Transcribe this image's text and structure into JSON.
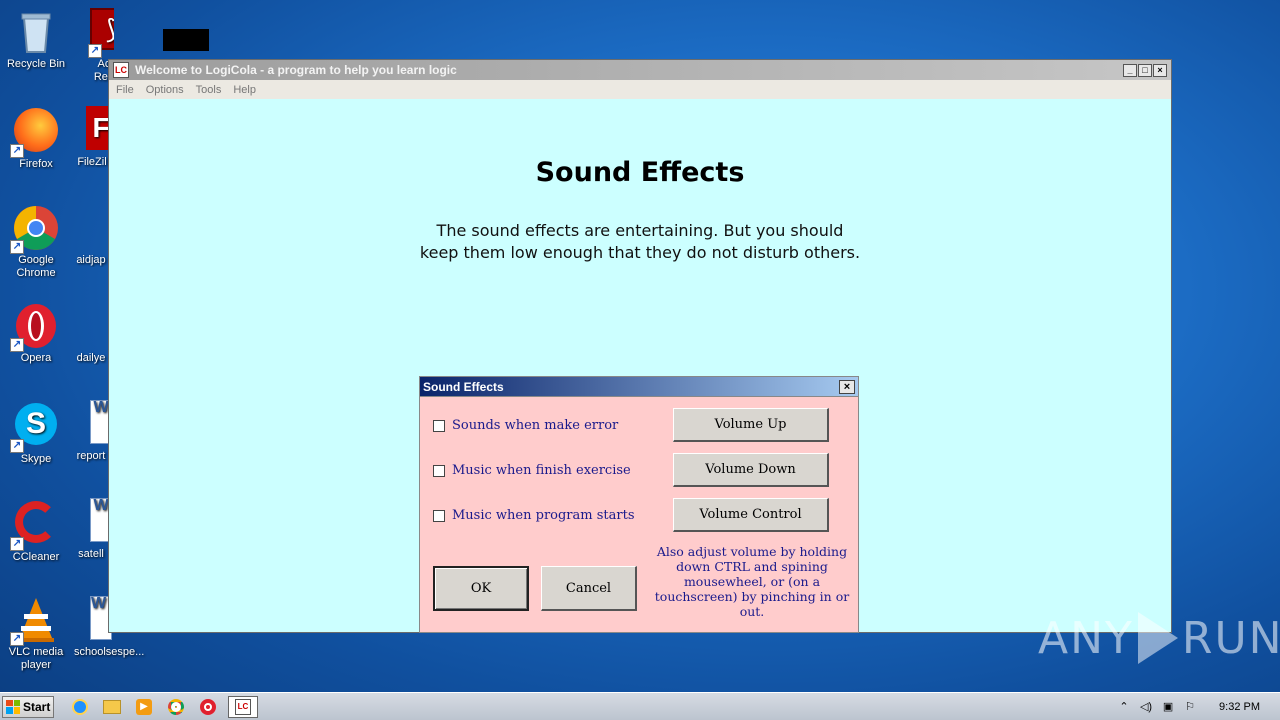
{
  "desktop": {
    "icons": [
      {
        "label": "Recycle Bin",
        "icon": "recycle-bin-icon"
      },
      {
        "label": "Acr Rea",
        "icon": "acrobat-reader-icon"
      },
      {
        "label": "Firefox",
        "icon": "firefox-icon"
      },
      {
        "label": "FileZil",
        "icon": "filezilla-icon"
      },
      {
        "label": "Google Chrome",
        "icon": "chrome-icon"
      },
      {
        "label": "aidjap",
        "icon": "file-icon"
      },
      {
        "label": "Opera",
        "icon": "opera-icon"
      },
      {
        "label": "dailye",
        "icon": "file-icon"
      },
      {
        "label": "Skype",
        "icon": "skype-icon"
      },
      {
        "label": "report",
        "icon": "word-doc-icon"
      },
      {
        "label": "CCleaner",
        "icon": "ccleaner-icon"
      },
      {
        "label": "satell",
        "icon": "word-doc-icon"
      },
      {
        "label": "VLC media player",
        "icon": "vlc-icon"
      },
      {
        "label": "schoolsespe...",
        "icon": "word-doc-icon"
      }
    ]
  },
  "window": {
    "title": "Welcome to LogiCola - a program to help you learn logic",
    "controls": {
      "minimize": "_",
      "maximize": "□",
      "close": "×"
    },
    "menu": [
      "File",
      "Options",
      "Tools",
      "Help"
    ],
    "content_bg": "#ccffff",
    "heading": "Sound Effects",
    "text_line1": "The sound effects are entertaining. But you should",
    "text_line2": "keep them low enough that they do not disturb others."
  },
  "dialog": {
    "title": "Sound Effects",
    "close": "×",
    "bg": "#ffcccc",
    "checkboxes": [
      {
        "label": "Sounds when make error",
        "checked": false
      },
      {
        "label": "Music when finish exercise",
        "checked": false
      },
      {
        "label": "Music when program starts",
        "checked": false
      }
    ],
    "volume_up": "Volume Up",
    "volume_down": "Volume Down",
    "volume_control": "Volume Control",
    "ok": "OK",
    "cancel": "Cancel",
    "note": "Also adjust volume by holding down CTRL and spining mousewheel, or (on a touchscreen) by pinching in or out."
  },
  "watermark": {
    "left": "ANY",
    "right": "RUN"
  },
  "taskbar": {
    "start": "Start",
    "apps": [
      "ie-icon",
      "explorer-icon",
      "media-player-icon",
      "chrome-icon",
      "opera-icon",
      "logicola-icon"
    ],
    "clock": "9:32 PM"
  }
}
